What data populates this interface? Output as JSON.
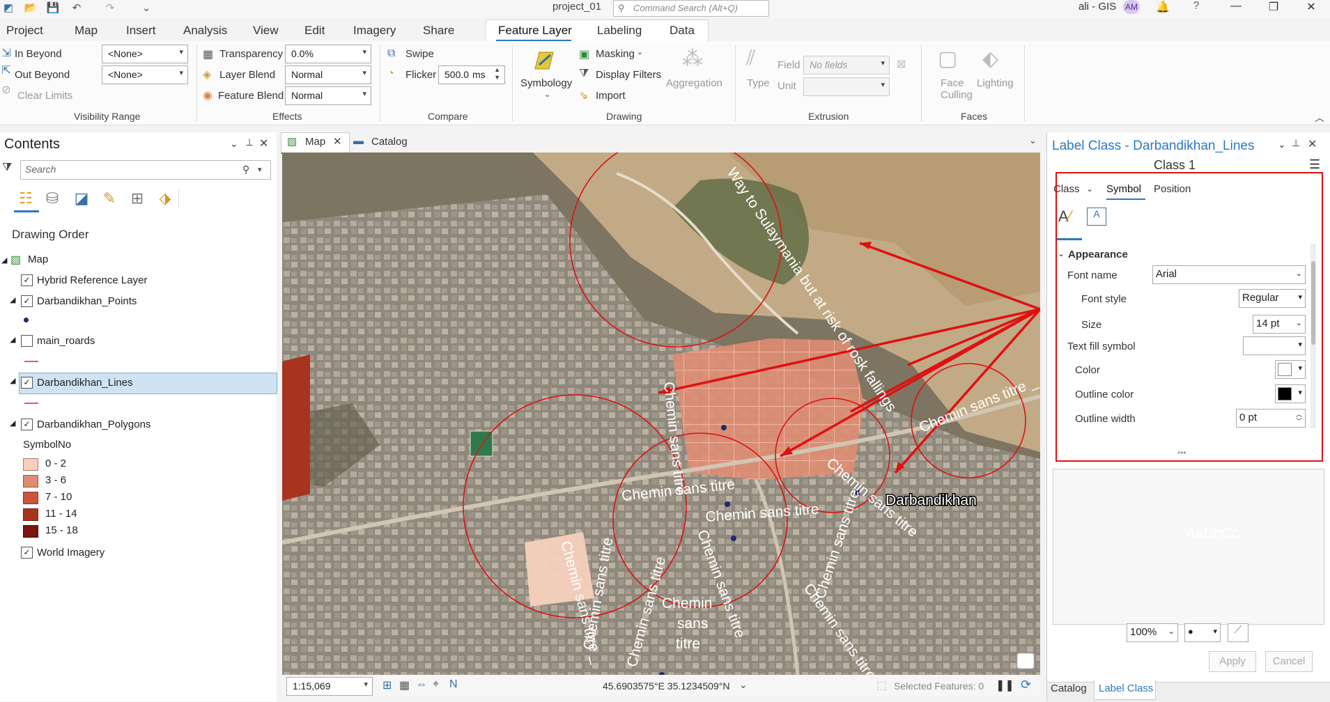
{
  "titlebar": {
    "project": "project_01",
    "command_search": "Command Search (Alt+Q)",
    "user": "ali - GIS",
    "avatar": "AM"
  },
  "ribbon_tabs": [
    "Project",
    "Map",
    "Insert",
    "Analysis",
    "View",
    "Edit",
    "Imagery",
    "Share",
    "Feature Layer",
    "Labeling",
    "Data"
  ],
  "ribbon": {
    "visibility": {
      "in_beyond": "In Beyond",
      "out_beyond": "Out Beyond",
      "clear_limits": "Clear Limits",
      "in_value": "<None>",
      "out_value": "<None>",
      "group": "Visibility Range"
    },
    "effects": {
      "transparency": "Transparency",
      "transparency_value": "0.0%",
      "layer_blend": "Layer Blend",
      "layer_blend_value": "Normal",
      "feature_blend": "Feature Blend",
      "feature_blend_value": "Normal",
      "group": "Effects"
    },
    "compare": {
      "swipe": "Swipe",
      "flicker": "Flicker",
      "flicker_value": "500.0",
      "flicker_unit": "ms",
      "group": "Compare"
    },
    "drawing": {
      "symbology": "Symbology",
      "masking": "Masking",
      "display_filters": "Display Filters",
      "import": "Import",
      "aggregation": "Aggregation",
      "group": "Drawing"
    },
    "extrusion": {
      "type": "Type",
      "field": "Field",
      "field_value": "No fields",
      "unit": "Unit",
      "group": "Extrusion"
    },
    "faces": {
      "face_culling": "Face Culling",
      "lighting": "Lighting",
      "group": "Faces"
    }
  },
  "contents": {
    "title": "Contents",
    "search_placeholder": "Search",
    "drawing_order": "Drawing Order",
    "map": "Map",
    "layers": {
      "hybrid": "Hybrid Reference Layer",
      "points": "Darbandikhan_Points",
      "roads": "main_roards",
      "lines": "Darbandikhan_Lines",
      "polygons": "Darbandikhan_Polygons",
      "symbol_field": "SymbolNo",
      "imagery": "World Imagery"
    },
    "classes": [
      {
        "label": "0 - 2",
        "color": "#f6d0bd"
      },
      {
        "label": "3 - 6",
        "color": "#df8d73"
      },
      {
        "label": "7 - 10",
        "color": "#c9553d"
      },
      {
        "label": "11 - 14",
        "color": "#a8341f"
      },
      {
        "label": "15 - 18",
        "color": "#7a1512"
      }
    ]
  },
  "map_tabs": {
    "map": "Map",
    "catalog": "Catalog"
  },
  "map_labels": {
    "sulaymania": "Way to Sulaymania but at risk of rosk fallings",
    "chemin": "Chemin sans titre",
    "chemin_trail": "Chemin sans titre _",
    "chemin_a": "Chemin",
    "chemin_b": "sans",
    "chemin_c": "titre",
    "city": "Darbandikhan"
  },
  "map_status": {
    "scale": "1:15,069",
    "coords": "45.6903575°E 35.1234509°N",
    "selected": "Selected Features: 0"
  },
  "label_class": {
    "title": "Label Class - Darbandikhan_Lines",
    "class_name": "Class 1",
    "tabs": {
      "class": "Class",
      "symbol": "Symbol",
      "position": "Position"
    },
    "appearance": "Appearance",
    "font_name_label": "Font name",
    "font_name": "Arial",
    "font_style_label": "Font style",
    "font_style": "Regular",
    "size_label": "Size",
    "size": "14 pt",
    "text_fill_label": "Text fill symbol",
    "color_label": "Color",
    "color": "#ffffff",
    "outline_color_label": "Outline color",
    "outline_color": "#000000",
    "outline_width_label": "Outline width",
    "outline_width": "0 pt",
    "preview": "AaBbCc",
    "zoom": "100%",
    "apply": "Apply",
    "cancel": "Cancel"
  },
  "bottom_tabs": {
    "catalog": "Catalog",
    "label_class": "Label Class"
  }
}
